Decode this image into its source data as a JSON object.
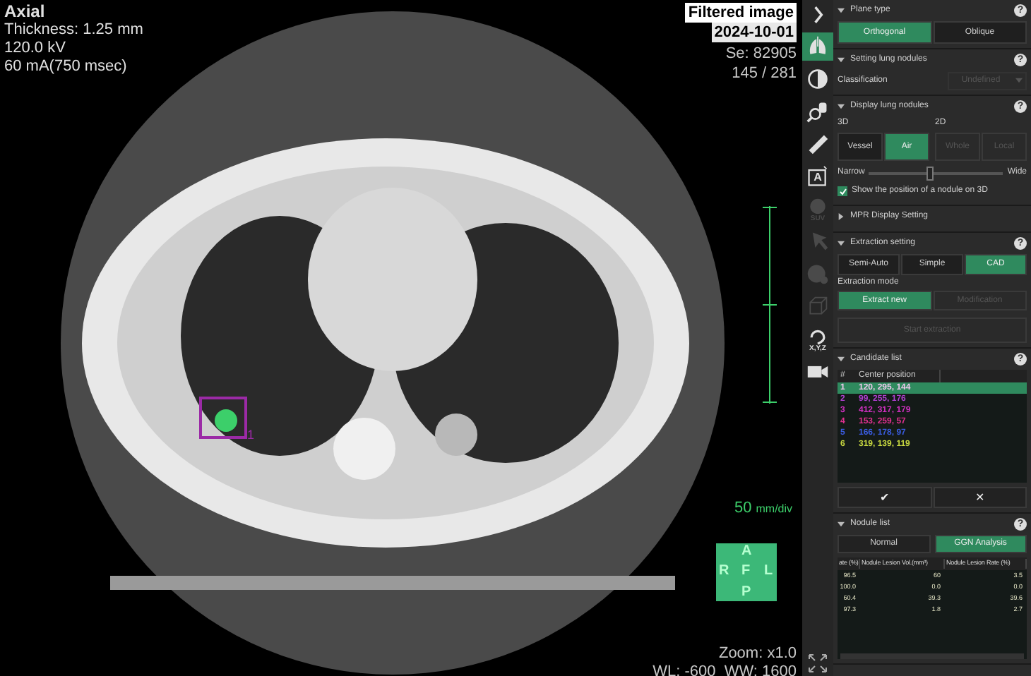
{
  "viewer": {
    "plane": "Axial",
    "info": [
      "Thickness: 1.25 mm",
      "120.0 kV",
      "60 mA(750 msec)"
    ],
    "badges": [
      "Filtered image",
      "2024-10-01"
    ],
    "series": "Se: 82905",
    "slice": "145 / 281",
    "scale": {
      "value": "50",
      "unit": "mm/div"
    },
    "orientation": {
      "top": "A",
      "left": "R",
      "center": "F",
      "right": "L",
      "bottom": "P"
    },
    "nodule_marker": {
      "label": "1",
      "color": "#9b2aa6"
    },
    "zoom": "Zoom: x1.0",
    "window": "WL: -600  WW: 1600"
  },
  "toolbar": [
    {
      "kind": "chevron",
      "active": false,
      "disabled": false
    },
    {
      "kind": "lungs",
      "active": true,
      "disabled": false
    },
    {
      "kind": "contrast",
      "active": false,
      "disabled": false
    },
    {
      "kind": "magnify",
      "active": false,
      "disabled": false
    },
    {
      "kind": "ruler",
      "active": false,
      "disabled": false
    },
    {
      "kind": "annotate",
      "label": "A",
      "active": false,
      "disabled": false
    },
    {
      "kind": "suv",
      "label": "SUV",
      "active": false,
      "disabled": true
    },
    {
      "kind": "pointer",
      "active": false,
      "disabled": true
    },
    {
      "kind": "sphere",
      "active": false,
      "disabled": true
    },
    {
      "kind": "cube",
      "active": false,
      "disabled": true
    },
    {
      "kind": "rotate",
      "label": "X,Y,Z",
      "active": false,
      "disabled": false
    },
    {
      "kind": "camera",
      "active": false,
      "disabled": false
    }
  ],
  "panel": {
    "plane_type": {
      "title": "Plane type",
      "help": "?",
      "expanded": true,
      "options": [
        {
          "label": "Orthogonal",
          "selected": true,
          "disabled": false
        },
        {
          "label": "Oblique",
          "selected": false,
          "disabled": false
        }
      ]
    },
    "setting_lung_nodules": {
      "title": "Setting lung nodules",
      "help": "?",
      "expanded": true,
      "classification": {
        "label": "Classification",
        "value": "Undefined",
        "disabled": true
      }
    },
    "display_lung_nodules": {
      "title": "Display lung nodules",
      "help": "?",
      "expanded": true,
      "label_3d": "3D",
      "label_2d": "2D",
      "options_3d": [
        {
          "label": "Vessel",
          "selected": false,
          "disabled": false
        },
        {
          "label": "Air",
          "selected": true,
          "disabled": false
        }
      ],
      "options_2d": [
        {
          "label": "Whole",
          "selected": false,
          "disabled": true
        },
        {
          "label": "Local",
          "selected": false,
          "disabled": true
        }
      ],
      "slider": {
        "min_label": "Narrow",
        "max_label": "Wide",
        "level": 0.45
      },
      "show_position": {
        "label": "Show the position of a nodule on 3D",
        "checked": true
      }
    },
    "mpr_display_setting": {
      "title": "MPR Display Setting",
      "expanded": false
    },
    "extraction_setting": {
      "title": "Extraction setting",
      "help": "?",
      "expanded": true,
      "methods": [
        {
          "label": "Semi-Auto",
          "selected": false,
          "disabled": false
        },
        {
          "label": "Simple",
          "selected": false,
          "disabled": false
        },
        {
          "label": "CAD",
          "selected": true,
          "disabled": false
        }
      ],
      "mode_label": "Extraction mode",
      "modes": [
        {
          "label": "Extract new",
          "selected": true,
          "disabled": false
        },
        {
          "label": "Modification",
          "selected": false,
          "disabled": true
        }
      ],
      "start_button": {
        "label": "Start extraction",
        "disabled": true
      }
    },
    "candidate_list": {
      "title": "Candidate list",
      "help": "?",
      "expanded": true,
      "columns": [
        "#",
        "Center position"
      ],
      "rows": [
        {
          "id": "1",
          "position": "120, 295, 144",
          "selected": true
        },
        {
          "id": "2",
          "position": "99, 255, 176",
          "color": "#b040d0",
          "selected": false
        },
        {
          "id": "3",
          "position": "412, 317, 179",
          "color": "#d030c0",
          "selected": false
        },
        {
          "id": "4",
          "position": "153, 259, 57",
          "color": "#e03090",
          "selected": false
        },
        {
          "id": "5",
          "position": "166, 178, 97",
          "color": "#3a5ce0",
          "selected": false
        },
        {
          "id": "6",
          "position": "319, 139, 119",
          "color": "#c8d840",
          "selected": false
        }
      ],
      "buttons": [
        "✔",
        "✕"
      ]
    },
    "nodule_list": {
      "title": "Nodule list",
      "help": "?",
      "expanded": true,
      "tabs": [
        {
          "label": "Normal",
          "selected": false
        },
        {
          "label": "GGN Analysis",
          "selected": true
        }
      ],
      "columns": [
        "ate (%)",
        "Nodule Lesion Vol.(mm³)",
        "Nodule Lesion Rate (%)"
      ],
      "rows": [
        [
          "96.5",
          "60",
          "3.5"
        ],
        [
          "100.0",
          "0.0",
          "0.0"
        ],
        [
          "60.4",
          "39.3",
          "39.6"
        ],
        [
          "97.3",
          "1.8",
          "2.7"
        ]
      ]
    }
  }
}
